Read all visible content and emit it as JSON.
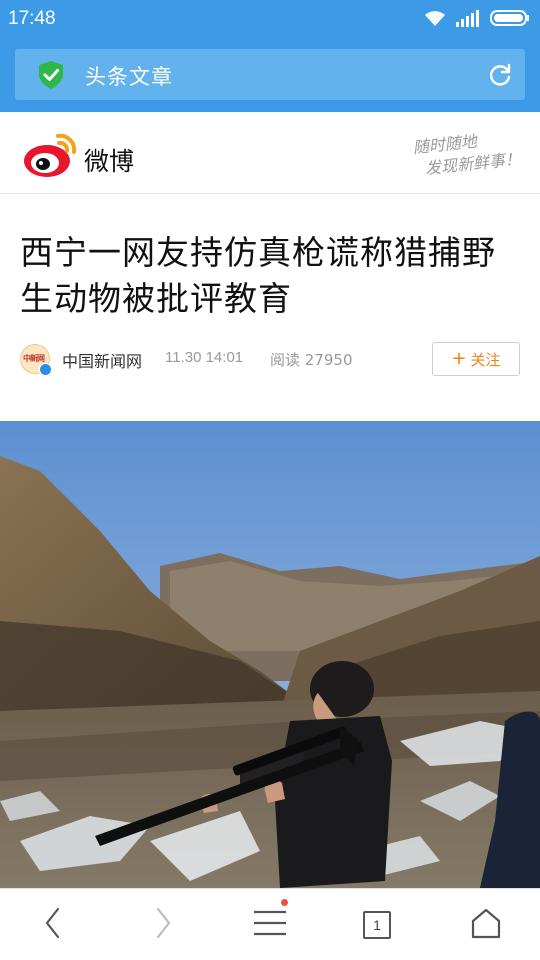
{
  "status_bar": {
    "time": "17:48",
    "icons": [
      "wifi-icon",
      "signal-icon",
      "battery-icon"
    ]
  },
  "address_bar": {
    "title": "头条文章",
    "secure_icon": "shield-check-icon",
    "reload_icon": "reload-icon"
  },
  "weibo_header": {
    "brand": "微博",
    "slogan_line1": "随时随地",
    "slogan_line2": "发现新鲜事！"
  },
  "article": {
    "title": "西宁一网友持仿真枪谎称猎捕野生动物被批评教育",
    "author_avatar_text": "中新网",
    "author": "中国新闻网",
    "time": "11.30 14:01",
    "reads": "阅读 27950",
    "follow_label": "关注",
    "follow_plus": "+"
  },
  "toolbar": {
    "back_icon": "chevron-left-icon",
    "forward_icon": "chevron-right-icon",
    "menu_icon": "menu-icon",
    "tab_count": "1",
    "home_icon": "home-icon"
  },
  "colors": {
    "top_bar": "#3c9ae6",
    "address_field": "#62b2ee",
    "follow_accent": "#f08214",
    "weibo_red": "#e6162d",
    "notification_dot": "#f24b3f"
  }
}
